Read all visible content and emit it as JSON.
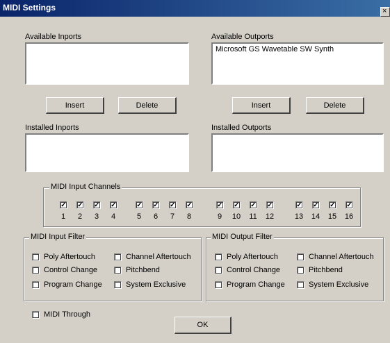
{
  "window": {
    "title": "MIDI Settings",
    "close_glyph": "×"
  },
  "inports": {
    "available_label": "Available Inports",
    "available_items": [],
    "installed_label": "Installed Inports",
    "installed_items": [],
    "insert_label": "Insert",
    "delete_label": "Delete"
  },
  "outports": {
    "available_label": "Available Outports",
    "available_items": [
      "Microsoft GS Wavetable SW Synth"
    ],
    "installed_label": "Installed Outports",
    "installed_items": [],
    "insert_label": "Insert",
    "delete_label": "Delete"
  },
  "channels": {
    "label": "MIDI Input Channels",
    "items": [
      {
        "num": "1",
        "checked": true
      },
      {
        "num": "2",
        "checked": true
      },
      {
        "num": "3",
        "checked": true
      },
      {
        "num": "4",
        "checked": true
      },
      {
        "num": "5",
        "checked": true
      },
      {
        "num": "6",
        "checked": true
      },
      {
        "num": "7",
        "checked": true
      },
      {
        "num": "8",
        "checked": true
      },
      {
        "num": "9",
        "checked": true
      },
      {
        "num": "10",
        "checked": true
      },
      {
        "num": "11",
        "checked": true
      },
      {
        "num": "12",
        "checked": true
      },
      {
        "num": "13",
        "checked": true
      },
      {
        "num": "14",
        "checked": true
      },
      {
        "num": "15",
        "checked": true
      },
      {
        "num": "16",
        "checked": true
      }
    ]
  },
  "input_filter": {
    "label": "MIDI Input Filter",
    "items": [
      {
        "label": "Poly Aftertouch",
        "checked": false
      },
      {
        "label": "Channel Aftertouch",
        "checked": false
      },
      {
        "label": "Control Change",
        "checked": false
      },
      {
        "label": "Pitchbend",
        "checked": false
      },
      {
        "label": "Program Change",
        "checked": false
      },
      {
        "label": "System Exclusive",
        "checked": false
      }
    ]
  },
  "output_filter": {
    "label": "MIDI Output Filter",
    "items": [
      {
        "label": "Poly Aftertouch",
        "checked": false
      },
      {
        "label": "Channel Aftertouch",
        "checked": false
      },
      {
        "label": "Control Change",
        "checked": false
      },
      {
        "label": "Pitchbend",
        "checked": false
      },
      {
        "label": "Program Change",
        "checked": false
      },
      {
        "label": "System Exclusive",
        "checked": false
      }
    ]
  },
  "through": {
    "label": "MIDI Through",
    "checked": false
  },
  "ok_label": "OK",
  "check_glyph": "✓"
}
